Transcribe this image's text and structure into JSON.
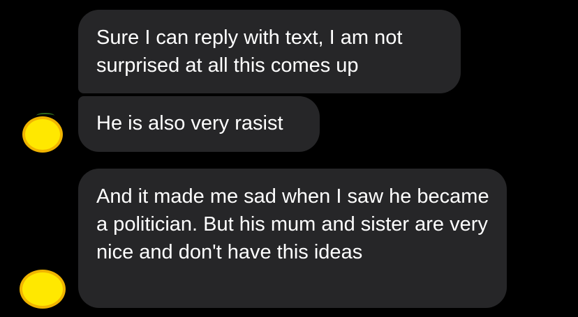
{
  "conversation": {
    "messages": [
      {
        "text": "Sure I can reply with text, I am not surprised at all this comes up"
      },
      {
        "text": "He is also very rasist"
      },
      {
        "text": "And it made me sad when I saw he became a politician. But his mum and sister are very nice and don't have this ideas"
      }
    ]
  },
  "colors": {
    "background": "#000000",
    "bubble": "#262628",
    "text": "#ffffff",
    "avatar_fill": "#FFE800",
    "avatar_border": "#F0B400"
  },
  "icons": {
    "avatar_1": "avatar-icon",
    "avatar_2": "avatar-icon"
  }
}
